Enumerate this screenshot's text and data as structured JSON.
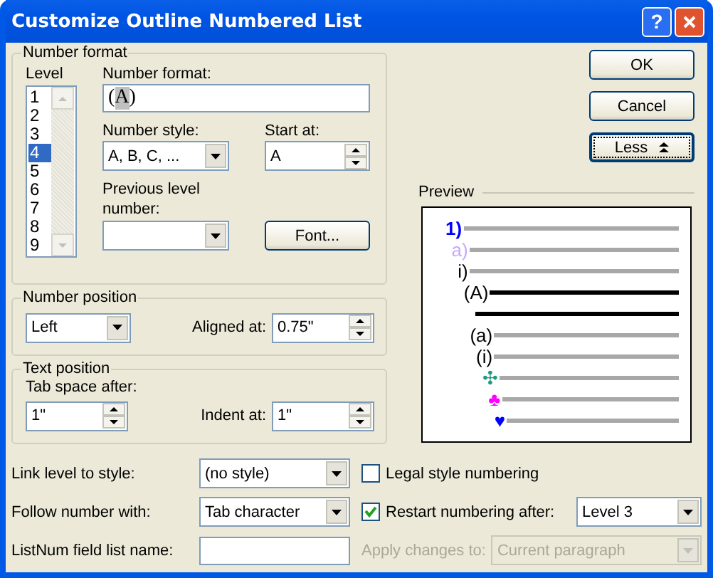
{
  "window": {
    "title": "Customize Outline Numbered List",
    "help_button": "?"
  },
  "number_format": {
    "title": "Number format",
    "level_label": "Level",
    "levels": [
      {
        "label": "1",
        "selected": false
      },
      {
        "label": "2",
        "selected": false
      },
      {
        "label": "3",
        "selected": false
      },
      {
        "label": "4",
        "selected": true
      },
      {
        "label": "5",
        "selected": false
      },
      {
        "label": "6",
        "selected": false
      },
      {
        "label": "7",
        "selected": false
      },
      {
        "label": "8",
        "selected": false
      },
      {
        "label": "9",
        "selected": false
      }
    ],
    "format_label": "Number format:",
    "format_parts": [
      {
        "text": "(",
        "shaded": false
      },
      {
        "text": "A",
        "shaded": true
      },
      {
        "text": ")",
        "shaded": false
      }
    ],
    "style_label": "Number style:",
    "style_value": "A, B, C, ...",
    "start_label": "Start at:",
    "start_value": "A",
    "previous_label": "Previous level number:",
    "font_button": "Font..."
  },
  "number_position": {
    "title": "Number position",
    "alignment": "Left",
    "aligned_label": "Aligned at:",
    "aligned_value": "0.75\""
  },
  "text_position": {
    "title": "Text position",
    "tab_label": "Tab space after:",
    "tab_value": "1\"",
    "indent_label": "Indent at:",
    "indent_value": "1\""
  },
  "buttons": [
    {
      "label": "OK",
      "kind": "plain",
      "focused": false
    },
    {
      "label": "Cancel",
      "kind": "plain",
      "focused": false
    },
    {
      "label": "Less",
      "kind": "expander",
      "focused": true
    }
  ],
  "preview": {
    "title": "Preview",
    "lines": [
      {
        "label": "1)",
        "color": "#0000ff",
        "selected": false
      },
      {
        "label": "a)",
        "color": "#c8a8ff",
        "selected": false
      },
      {
        "label": "i)",
        "color": "#000000",
        "selected": false
      },
      {
        "label": "(A)",
        "color": "#000000",
        "selected": true
      },
      {
        "label": "(a)",
        "color": "#000000",
        "selected": false
      },
      {
        "label": "(i)",
        "color": "#000000",
        "selected": false
      },
      {
        "label": "✣",
        "color": "#209a80",
        "selected": false
      },
      {
        "label": "♣",
        "color": "#ff00ff",
        "selected": false
      },
      {
        "label": "♥",
        "color": "#0000ff",
        "selected": false
      }
    ]
  },
  "link_level": {
    "label": "Link level to style:",
    "value": "(no style)"
  },
  "legal_numbering": {
    "label": "Legal style numbering",
    "checked": false
  },
  "follow_number": {
    "label": "Follow number with:",
    "value": "Tab character"
  },
  "restart_numbering": {
    "label": "Restart numbering after:",
    "checked": true,
    "value": "Level 3"
  },
  "listnum_name": {
    "label": "ListNum field list name:"
  },
  "apply_changes": {
    "label": "Apply changes to:",
    "value": "Current paragraph",
    "disabled": true
  }
}
